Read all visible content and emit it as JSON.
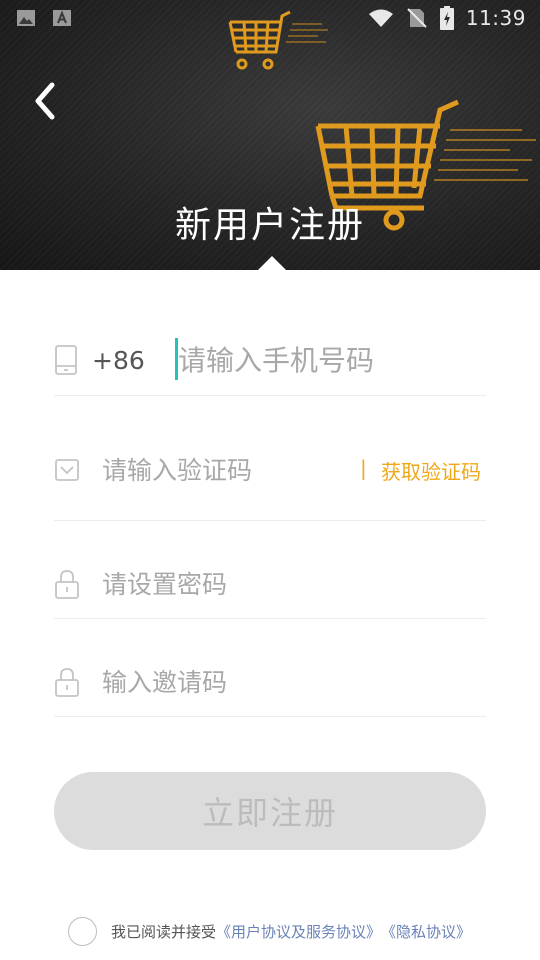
{
  "status_bar": {
    "time": "11:39",
    "left_icons": [
      "image-icon",
      "text-a-icon"
    ],
    "right_icons": [
      "wifi-icon",
      "no-sim-icon",
      "battery-charging-icon"
    ]
  },
  "header": {
    "title": "新用户注册",
    "back_icon": "chevron-left-icon",
    "decor_icons": [
      "shopping-cart-icon",
      "shopping-cart-icon"
    ],
    "accent": "#e09a1e"
  },
  "form": {
    "phone": {
      "icon": "phone-icon",
      "country_code": "+86",
      "placeholder": "请输入手机号码",
      "value": ""
    },
    "verification": {
      "icon": "message-icon",
      "placeholder": "请输入验证码",
      "separator": "|",
      "get_code_label": "获取验证码"
    },
    "password": {
      "icon": "lock-icon",
      "placeholder": "请设置密码"
    },
    "invite": {
      "icon": "lock-icon",
      "placeholder": "输入邀请码"
    }
  },
  "register_button": {
    "label": "立即注册",
    "enabled": false
  },
  "agreement": {
    "prefix": "我已阅读并接受",
    "user_agreement": "《用户协议及服务协议》",
    "privacy_policy": "《隐私协议》",
    "checked": false,
    "link_color": "#6a82b8"
  },
  "colors": {
    "accent_orange": "#f0a81a",
    "caret_teal": "#22c3b8",
    "button_disabled_bg": "#dcdcdc"
  }
}
